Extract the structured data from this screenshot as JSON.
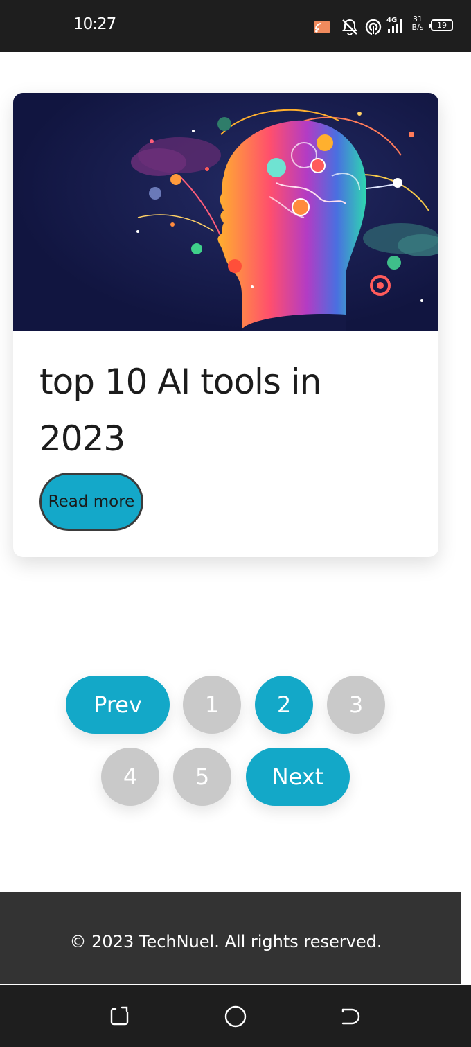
{
  "status_bar": {
    "time": "10:27",
    "net_speed_value": "31",
    "net_speed_unit": "B/s",
    "battery": "19",
    "icons": [
      "cast-icon",
      "notifications-off-icon",
      "hotspot-icon",
      "signal-4g-icon"
    ]
  },
  "card": {
    "image_description_icon": "ai-head-illustration",
    "title": "top 10 AI tools in 2023",
    "read_more_label": "Read more"
  },
  "pagination": {
    "prev_label": "Prev",
    "next_label": "Next",
    "pages": [
      "1",
      "2",
      "3",
      "4",
      "5"
    ],
    "current_page": "2"
  },
  "footer": {
    "text": "© 2023 TechNuel. All rights reserved."
  },
  "nav_bar": {
    "icons": [
      "recent-apps-icon",
      "home-icon",
      "back-icon"
    ]
  },
  "colors": {
    "accent": "#13a8c8",
    "muted": "#c9c9c9",
    "footer_bg": "#333333",
    "system_bar_bg": "#1e1e1e"
  }
}
